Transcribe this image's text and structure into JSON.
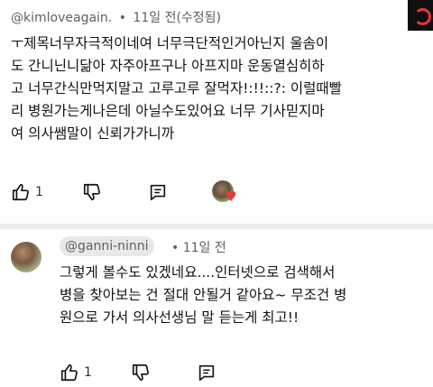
{
  "top_comment": {
    "handle": "@kimloveagain.",
    "separator": "•",
    "time": "11일 전(수정됨)",
    "lines": [
      "ㅜ제목너무자극적이네여 너무극단적인거아닌지 울솜이",
      "도 간니닌니닮아 자주아프구나 아프지마 운동열심히하",
      "고 너무간식만먹지말고 고루고루 잘먹자!:!!::?: 이럴때빨",
      "리 병원가는게나은데 아닐수도있어요 너무 기사믿지마",
      "여 의사쌤말이 신뢰가가니까"
    ],
    "like_count": "1",
    "creator_heart": "♥"
  },
  "reply": {
    "handle": "@ganni-ninni",
    "separator": "•",
    "time": "11일 전",
    "lines": [
      "그렇게 볼수도 있겠네요....인터넷으로 검색해서",
      "병을 찾아보는 건 절대 안될거 같아요~ 무조건 병",
      "원으로 가서 의사선생님 말 듣는게 최고!!"
    ],
    "like_count": "1"
  },
  "colors": {
    "heart": "#e53935",
    "meta_text": "#606060",
    "divider": "#ececec"
  }
}
